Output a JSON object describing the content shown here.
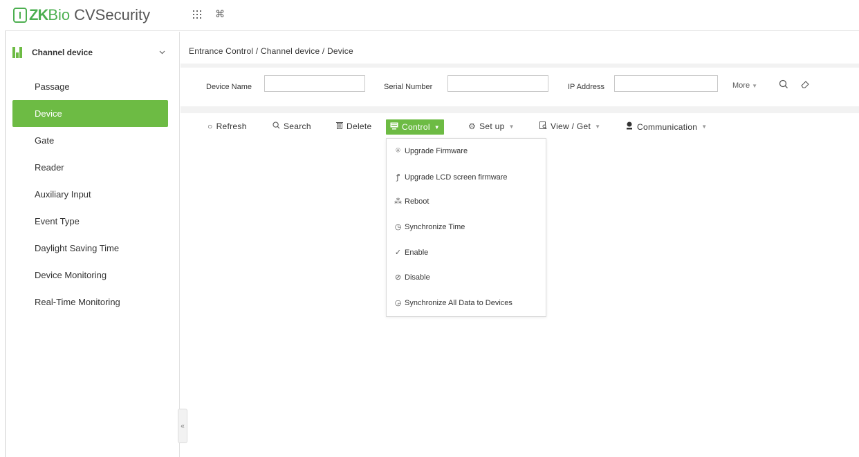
{
  "app": {
    "logo_zk": "ZK",
    "logo_bio": "Bio",
    "logo_product": "CVSecurity",
    "top_icons": [
      "apps-grid-icon",
      "command-icon"
    ]
  },
  "sidebar": {
    "module_title": "Channel device",
    "items": [
      {
        "label": "Passage",
        "active": false
      },
      {
        "label": "Device",
        "active": true
      },
      {
        "label": "Gate",
        "active": false
      },
      {
        "label": "Reader",
        "active": false
      },
      {
        "label": "Auxiliary Input",
        "active": false
      },
      {
        "label": "Event Type",
        "active": false
      },
      {
        "label": "Daylight Saving Time",
        "active": false
      },
      {
        "label": "Device Monitoring",
        "active": false
      },
      {
        "label": "Real-Time Monitoring",
        "active": false
      }
    ]
  },
  "breadcrumb": "Entrance Control / Channel device / Device",
  "filters": {
    "device_name_label": "Device Name",
    "device_name_value": "",
    "serial_number_label": "Serial Number",
    "serial_number_value": "",
    "ip_address_label": "IP Address",
    "ip_address_value": "",
    "more_label": "More"
  },
  "toolbar": {
    "refresh": "Refresh",
    "search": "Search",
    "delete": "Delete",
    "control": "Control",
    "setup": "Set up",
    "view_get": "View / Get",
    "communication": "Communication"
  },
  "control_menu": {
    "items": [
      "Upgrade Firmware",
      "Upgrade LCD screen firmware",
      "Reboot",
      "Synchronize Time",
      "Enable",
      "Disable",
      "Synchronize All Data to Devices"
    ]
  },
  "colors": {
    "accent_green": "#6dbb44",
    "logo_green": "#4caf50"
  }
}
